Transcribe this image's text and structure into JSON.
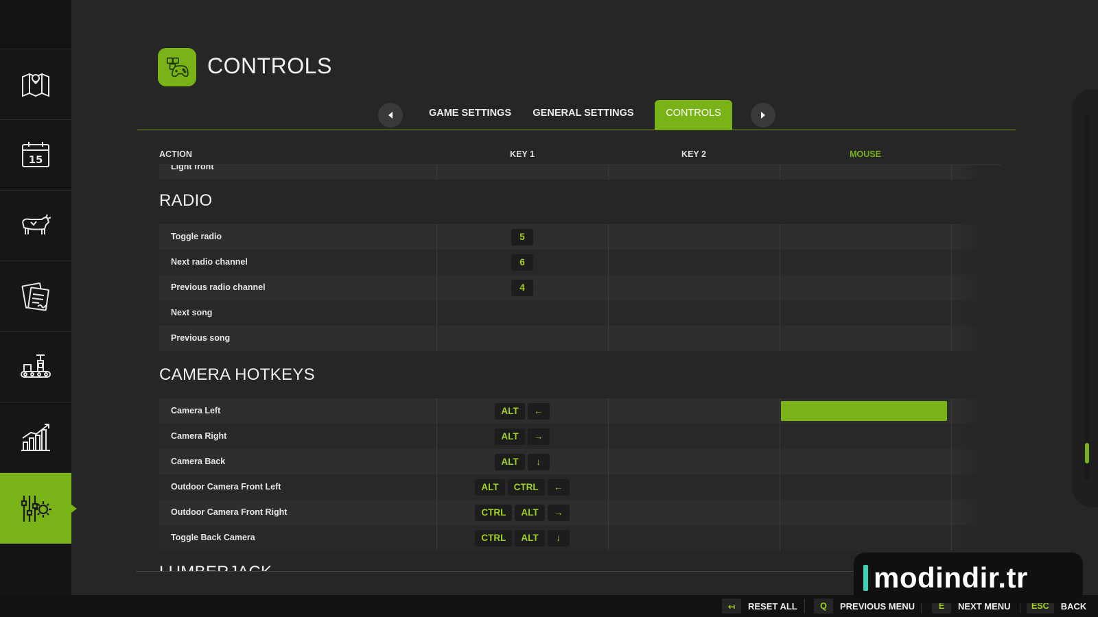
{
  "page": {
    "title": "CONTROLS"
  },
  "sidebar": {
    "items": [
      {
        "icon": "map-icon"
      },
      {
        "icon": "calendar-icon",
        "text": "15"
      },
      {
        "icon": "cow-icon"
      },
      {
        "icon": "contracts-icon"
      },
      {
        "icon": "production-icon"
      },
      {
        "icon": "statistics-icon"
      },
      {
        "icon": "settings-icon",
        "active": true
      }
    ]
  },
  "tabs": {
    "items": [
      "GAME SETTINGS",
      "GENERAL SETTINGS",
      "CONTROLS"
    ],
    "active": "CONTROLS"
  },
  "columns": {
    "action": "ACTION",
    "key1": "KEY 1",
    "key2": "KEY 2",
    "mouse": "MOUSE"
  },
  "table": {
    "top_row": "Light front",
    "sections": [
      {
        "title": "RADIO",
        "rows": [
          {
            "action": "Toggle radio",
            "keys": [
              "5"
            ]
          },
          {
            "action": "Next radio channel",
            "keys": [
              "6"
            ]
          },
          {
            "action": "Previous radio channel",
            "keys": [
              "4"
            ]
          },
          {
            "action": "Next song",
            "keys": []
          },
          {
            "action": "Previous song",
            "keys": []
          }
        ]
      },
      {
        "title": "CAMERA HOTKEYS",
        "rows": [
          {
            "action": "Camera Left",
            "keys": [
              "ALT",
              "←"
            ],
            "mouse_selected": true
          },
          {
            "action": "Camera Right",
            "keys": [
              "ALT",
              "→"
            ]
          },
          {
            "action": "Camera Back",
            "keys": [
              "ALT",
              "↓"
            ]
          },
          {
            "action": "Outdoor Camera Front Left",
            "keys": [
              "ALT",
              "CTRL",
              "←"
            ]
          },
          {
            "action": "Outdoor Camera Front Right",
            "keys": [
              "CTRL",
              "ALT",
              "→"
            ]
          },
          {
            "action": "Toggle Back Camera",
            "keys": [
              "CTRL",
              "ALT",
              "↓"
            ]
          }
        ]
      }
    ],
    "next_section_partial": "LUMBERJACK"
  },
  "footer": [
    {
      "key": "↤",
      "label": "RESET ALL"
    },
    {
      "key": "Q",
      "label": "PREVIOUS MENU"
    },
    {
      "key": "E",
      "label": "NEXT MENU"
    },
    {
      "key": "ESC",
      "label": "BACK"
    }
  ],
  "watermark": {
    "text": "modindir.tr"
  },
  "colors": {
    "accent": "#7ab317",
    "key_text": "#9fd21f",
    "background": "#262626",
    "sidebar": "#141414"
  }
}
